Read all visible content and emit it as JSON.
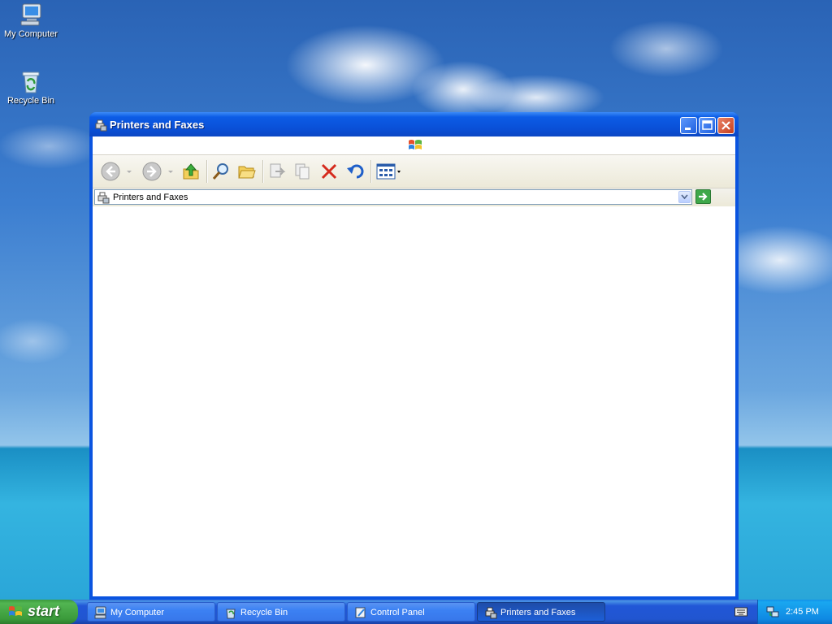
{
  "desktop": {
    "icons": [
      {
        "label": "My Computer",
        "icon": "computer-icon"
      },
      {
        "label": "Recycle Bin",
        "icon": "recycle-bin-icon"
      }
    ]
  },
  "window": {
    "title": "Printers and Faxes",
    "title_icon": "printer-fax-icon",
    "controls": [
      "minimize",
      "maximize",
      "close"
    ],
    "toolbar": [
      "back",
      "forward",
      "up",
      "search",
      "folders",
      "move-to",
      "copy-to",
      "delete",
      "undo",
      "views"
    ],
    "address": {
      "value": "Printers and Faxes"
    }
  },
  "taskbar": {
    "start_label": "start",
    "tasks": [
      {
        "label": "My Computer",
        "icon": "computer-icon",
        "active": false
      },
      {
        "label": "Recycle Bin",
        "icon": "recycle-bin-icon",
        "active": false
      },
      {
        "label": "Control Panel",
        "icon": "control-panel-icon",
        "active": false
      },
      {
        "label": "Printers and Faxes",
        "icon": "printer-fax-icon",
        "active": true
      }
    ],
    "clock": "2:45 PM"
  },
  "colors": {
    "title_blue": "#0a54e0",
    "start_green": "#3a9a3a",
    "close_red": "#c63d1c",
    "taskbar_blue": "#2155d0"
  }
}
